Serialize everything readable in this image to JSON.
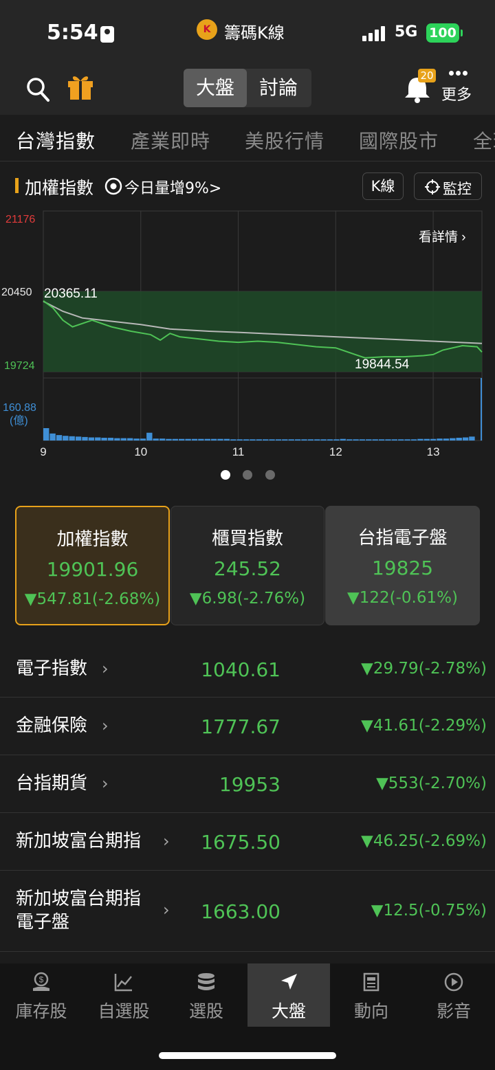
{
  "status_bar": {
    "time": "5:54",
    "app_badge": "K",
    "app_name": "籌碼K線",
    "network": "5G",
    "battery": "100"
  },
  "header": {
    "segments": [
      "大盤",
      "討論"
    ],
    "active_segment": "大盤",
    "notification_count": "20",
    "more_label": "更多"
  },
  "tabs": [
    "台灣指數",
    "產業即時",
    "美股行情",
    "國際股市",
    "全球"
  ],
  "chart_header": {
    "title": "加權指數",
    "volume_note": "今日量增9%>",
    "k_button": "K線",
    "watch_button": "監控"
  },
  "chart_data": {
    "type": "line",
    "y_labels": {
      "high": "21176",
      "ref": "20450",
      "low": "19724"
    },
    "start_label": "20365.11",
    "low_label": "19844.54",
    "detail_link": "看詳情 ›",
    "volume_label": "160.88",
    "volume_unit": "(億)",
    "x_ticks": [
      "9",
      "10",
      "11",
      "12",
      "13"
    ],
    "ylim": [
      19724,
      21176
    ],
    "reference": 20450,
    "session_hours": [
      9,
      13.5
    ],
    "index_series": {
      "t": [
        9.0,
        9.1,
        9.2,
        9.3,
        9.5,
        9.7,
        9.9,
        10.1,
        10.2,
        10.3,
        10.4,
        10.6,
        10.8,
        11.0,
        11.2,
        11.4,
        11.6,
        11.8,
        12.0,
        12.2,
        12.3,
        12.5,
        12.7,
        12.9,
        13.0,
        13.1,
        13.3,
        13.45,
        13.5
      ],
      "v": [
        20365.11,
        20300,
        20190,
        20130,
        20190,
        20130,
        20090,
        20060,
        20010,
        20070,
        20040,
        20020,
        20000,
        19990,
        20000,
        19990,
        19970,
        19950,
        19940,
        19880,
        19850,
        19860,
        19860,
        19870,
        19880,
        19920,
        19960,
        19950,
        19901.96
      ]
    },
    "average_series": {
      "t": [
        9.0,
        9.2,
        9.4,
        9.7,
        10.0,
        10.3,
        10.7,
        11.0,
        11.5,
        12.0,
        12.5,
        13.0,
        13.5
      ],
      "v": [
        20360,
        20270,
        20210,
        20180,
        20150,
        20110,
        20090,
        20080,
        20060,
        20040,
        20020,
        20000,
        19980
      ]
    },
    "volume_ylim": [
      0,
      160.88
    ],
    "volume_bars": [
      160.88,
      18,
      14,
      12,
      11,
      10,
      9,
      8,
      8,
      7,
      7,
      6,
      6,
      6,
      5,
      5,
      20,
      5,
      5,
      4,
      4,
      4,
      4,
      4,
      4,
      4,
      4,
      4,
      4,
      3,
      3,
      3,
      3,
      3,
      3,
      3,
      3,
      3,
      3,
      3,
      3,
      3,
      3,
      3,
      3,
      3,
      4,
      3,
      3,
      3,
      3,
      3,
      3,
      3,
      3,
      3,
      3,
      3,
      4,
      4,
      4,
      5,
      5,
      6,
      7,
      8,
      10,
      160.88
    ]
  },
  "cards": [
    {
      "name": "加權指數",
      "value": "19901.96",
      "change": "▼547.81(-2.68%)",
      "selected": true
    },
    {
      "name": "櫃買指數",
      "value": "245.52",
      "change": "▼6.98(-2.76%)",
      "selected": false
    },
    {
      "name": "台指電子盤",
      "value": "19825",
      "change": "▼122(-0.61%)",
      "selected": false
    }
  ],
  "list": [
    {
      "name": "電子指數",
      "value": "1040.61",
      "change": "▼29.79(-2.78%)"
    },
    {
      "name": "金融保險",
      "value": "1777.67",
      "change": "▼41.61(-2.29%)"
    },
    {
      "name": "台指期貨",
      "value": "19953",
      "change": "▼553(-2.70%)"
    },
    {
      "name": "新加坡富台期指",
      "value": "1675.50",
      "change": "▼46.25(-2.69%)"
    },
    {
      "name": "新加坡富台期指",
      "name2": "電子盤",
      "value": "1663.00",
      "change": "▼12.5(-0.75%)"
    }
  ],
  "bottom_nav": [
    {
      "label": "庫存股",
      "icon": "coin-hand-icon"
    },
    {
      "label": "自選股",
      "icon": "trend-chart-icon"
    },
    {
      "label": "選股",
      "icon": "database-icon"
    },
    {
      "label": "大盤",
      "icon": "navigation-arrow-icon",
      "active": true
    },
    {
      "label": "動向",
      "icon": "news-icon"
    },
    {
      "label": "影音",
      "icon": "play-circle-icon"
    }
  ],
  "colors": {
    "up_red": "#e23b3b",
    "down_green": "#4fc356",
    "accent_orange": "#e8a21a",
    "volume_blue": "#3f8fd6"
  }
}
